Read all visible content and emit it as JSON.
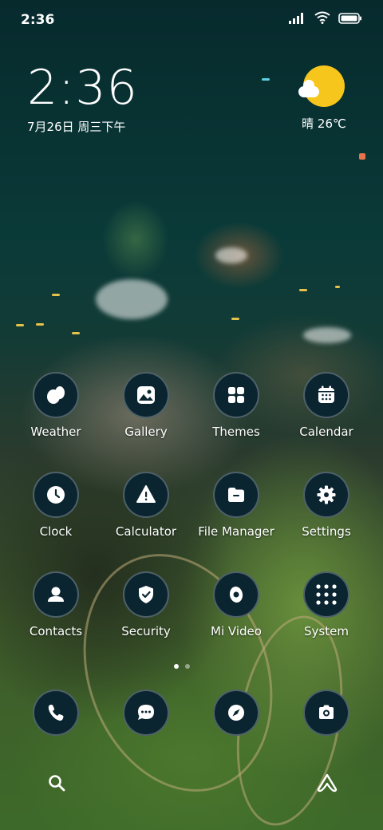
{
  "status_bar": {
    "time": "2:36"
  },
  "clock_widget": {
    "time": "2:36",
    "date": "7月26日 周三下午"
  },
  "weather_widget": {
    "text": "晴 26℃"
  },
  "apps": [
    {
      "label": "Weather"
    },
    {
      "label": "Gallery"
    },
    {
      "label": "Themes"
    },
    {
      "label": "Calendar"
    },
    {
      "label": "Clock"
    },
    {
      "label": "Calculator"
    },
    {
      "label": "File Manager"
    },
    {
      "label": "Settings"
    },
    {
      "label": "Contacts"
    },
    {
      "label": "Security"
    },
    {
      "label": "Mi Video"
    },
    {
      "label": "System"
    }
  ],
  "dock": [
    "phone-icon",
    "messages-icon",
    "browser-icon",
    "camera-icon"
  ],
  "pager": {
    "pages": 2,
    "active": 1
  },
  "colors": {
    "icon_bg": "#0b2530",
    "sun": "#f6c61c"
  }
}
